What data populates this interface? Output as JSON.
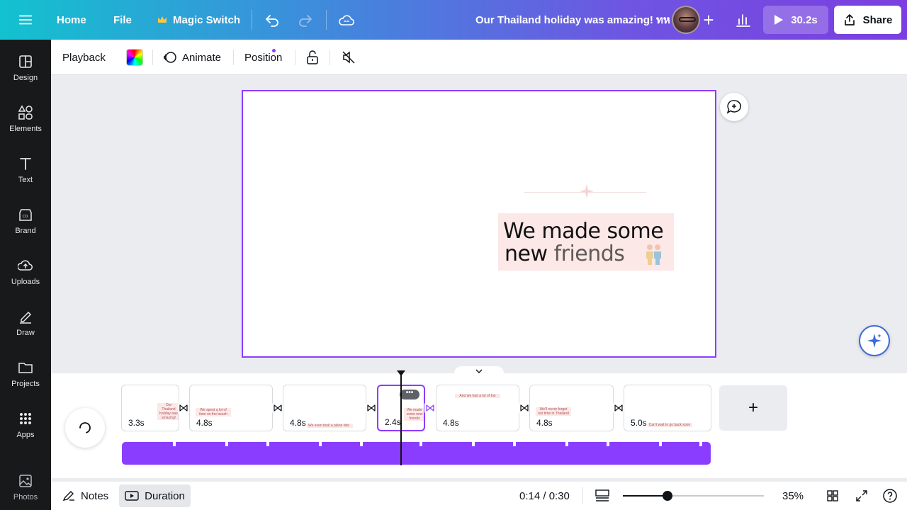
{
  "topbar": {
    "home": "Home",
    "file": "File",
    "magic_switch": "Magic Switch",
    "document_title": "Our Thailand holiday was amazing! ทห",
    "play_duration": "30.2s",
    "share": "Share"
  },
  "sidebar": {
    "items": [
      {
        "label": "Design",
        "icon": "design-icon"
      },
      {
        "label": "Elements",
        "icon": "elements-icon"
      },
      {
        "label": "Text",
        "icon": "text-icon"
      },
      {
        "label": "Brand",
        "icon": "brand-icon"
      },
      {
        "label": "Uploads",
        "icon": "uploads-icon"
      },
      {
        "label": "Draw",
        "icon": "draw-icon"
      },
      {
        "label": "Projects",
        "icon": "folder-icon"
      },
      {
        "label": "Apps",
        "icon": "apps-icon"
      },
      {
        "label": "Photos",
        "icon": "photos-icon"
      }
    ]
  },
  "toolbar": {
    "playback": "Playback",
    "animate": "Animate",
    "position": "Position"
  },
  "canvas": {
    "line1": "We made some",
    "line2_a": "new",
    "line2_b": "friends"
  },
  "timeline": {
    "scenes": [
      {
        "duration": "3.3s",
        "caption": "Our Thailand holiday was amazing!"
      },
      {
        "duration": "4.8s",
        "caption": "We spent a lot of time on the beach"
      },
      {
        "duration": "4.8s",
        "caption": "We even took a plane ride"
      },
      {
        "duration": "2.4s",
        "caption": "We made some new friends",
        "active": true
      },
      {
        "duration": "4.8s",
        "caption": "And we had a lot of fun"
      },
      {
        "duration": "4.8s",
        "caption": "We'll never forget our time in Thailand"
      },
      {
        "duration": "5.0s",
        "caption": "Can't wait to go back soon"
      }
    ],
    "add_scene": "+"
  },
  "footer": {
    "notes": "Notes",
    "duration": "Duration",
    "time": "0:14 / 0:30",
    "zoom_percent": "35%",
    "zoom_level": 0.35
  },
  "colors": {
    "accent": "#8b3dff",
    "sidebar_bg": "#18191b",
    "text_highlight": "#fde8e8"
  }
}
